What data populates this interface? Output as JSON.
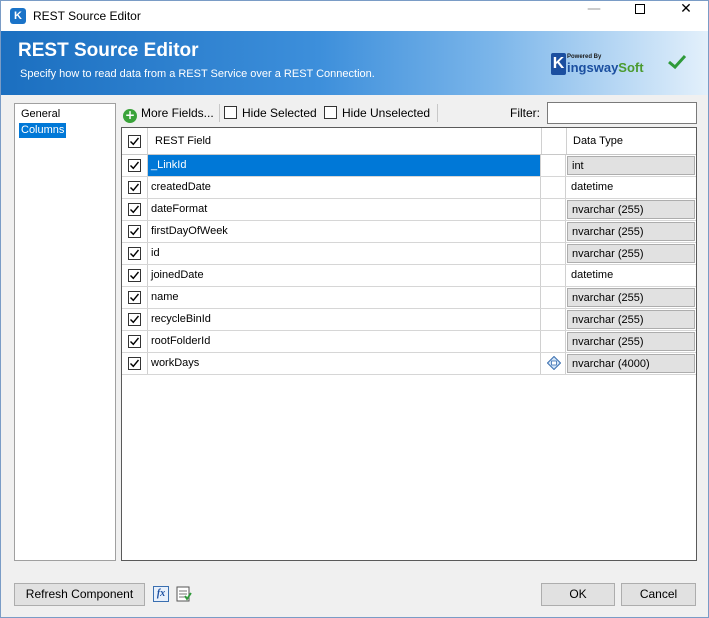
{
  "window": {
    "title": "REST Source Editor",
    "app_icon_letter": "K"
  },
  "banner": {
    "title": "REST Source Editor",
    "subtitle": "Specify how to read data from a REST Service over a REST Connection.",
    "brand_powered": "Powered By",
    "brand_k": "K",
    "brand_name_a": "ingsway",
    "brand_name_b": "Soft"
  },
  "nav": {
    "items": [
      {
        "label": "General",
        "selected": false
      },
      {
        "label": "Columns",
        "selected": true
      }
    ]
  },
  "toolbar": {
    "more_fields_label": "More Fields...",
    "hide_selected_label": "Hide Selected",
    "hide_unselected_label": "Hide Unselected",
    "filter_label": "Filter:",
    "filter_value": ""
  },
  "grid": {
    "headers": {
      "field": "REST Field",
      "type": "Data Type"
    },
    "header_checked": true,
    "rows": [
      {
        "name": "_LinkId",
        "type": "int",
        "checked": true,
        "selected": true,
        "type_boxed": true,
        "icon": null
      },
      {
        "name": "createdDate",
        "type": "datetime",
        "checked": true,
        "selected": false,
        "type_boxed": false,
        "icon": null
      },
      {
        "name": "dateFormat",
        "type": "nvarchar (255)",
        "checked": true,
        "selected": false,
        "type_boxed": true,
        "icon": null
      },
      {
        "name": "firstDayOfWeek",
        "type": "nvarchar (255)",
        "checked": true,
        "selected": false,
        "type_boxed": true,
        "icon": null
      },
      {
        "name": "id",
        "type": "nvarchar (255)",
        "checked": true,
        "selected": false,
        "type_boxed": true,
        "icon": null
      },
      {
        "name": "joinedDate",
        "type": "datetime",
        "checked": true,
        "selected": false,
        "type_boxed": false,
        "icon": null
      },
      {
        "name": "name",
        "type": "nvarchar (255)",
        "checked": true,
        "selected": false,
        "type_boxed": true,
        "icon": null
      },
      {
        "name": "recycleBinId",
        "type": "nvarchar (255)",
        "checked": true,
        "selected": false,
        "type_boxed": true,
        "icon": null
      },
      {
        "name": "rootFolderId",
        "type": "nvarchar (255)",
        "checked": true,
        "selected": false,
        "type_boxed": true,
        "icon": null
      },
      {
        "name": "workDays",
        "type": "nvarchar (4000)",
        "checked": true,
        "selected": false,
        "type_boxed": true,
        "icon": "array-diamond-icon"
      }
    ]
  },
  "footer": {
    "refresh_label": "Refresh Component",
    "fx_label": "fx",
    "ok_label": "OK",
    "cancel_label": "Cancel"
  },
  "colors": {
    "banner_start": "#1b6fc0",
    "selection": "#0078d7",
    "brand_blue": "#1b4fa0",
    "brand_green": "#4b9b2f"
  }
}
